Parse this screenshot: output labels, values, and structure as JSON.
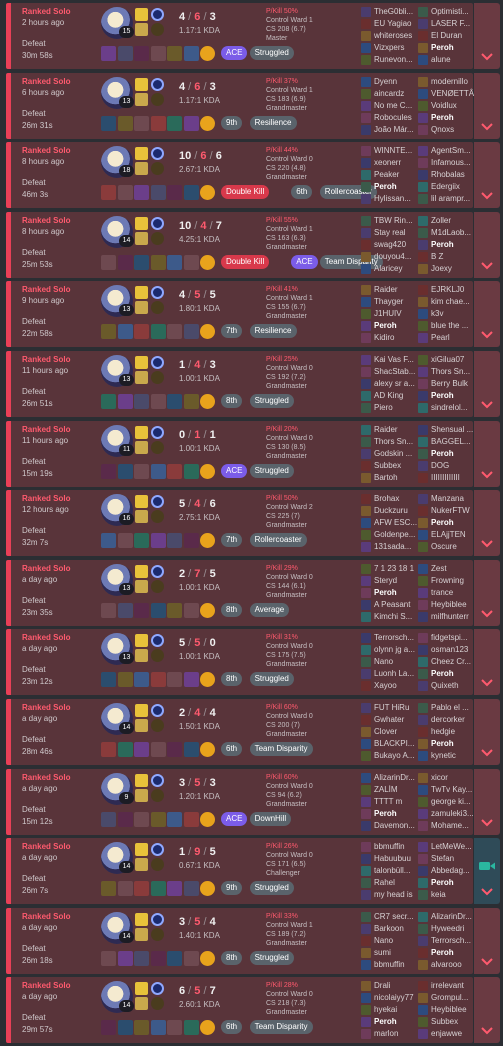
{
  "colors": {
    "defeat_bg": "#59343a",
    "defeat_border": "#e84057",
    "loss_text": "#ff5a6e",
    "badge_purple": "#7b5ce8",
    "badge_gray": "#5a636b",
    "badge_red": "#d8394b",
    "video_accent": "#2ab7a0"
  },
  "icons": {
    "expand": "chevron-down-icon",
    "video": "video-camera-icon"
  },
  "matches": [
    {
      "mode": "Ranked Solo",
      "ago": "2 hours ago",
      "result": "Defeat",
      "duration": "30m 58s",
      "level": "15",
      "kills": "4",
      "deaths": "6",
      "assists": "3",
      "kda": "1.17:1 KDA",
      "pkill": "P/Kill 50%",
      "ward": "Control Ward 1",
      "cs": "CS 208 (6.7)",
      "tier": "Master",
      "badges": [
        "ACE",
        "Struggled"
      ],
      "badge_colors": [
        "#7b5ce8",
        "#5a636b"
      ],
      "team1": [
        "TheG0bli...",
        "EU Yagiao",
        "whiteroses",
        "Vizxpers",
        "Runevon..."
      ],
      "team2": [
        "Optimisti...",
        "LASER F...",
        "El Duran",
        "Peroh",
        "alune"
      ],
      "me_team": 2,
      "me_index": 3,
      "items": "a",
      "video": false
    },
    {
      "mode": "Ranked Solo",
      "ago": "6 hours ago",
      "result": "Defeat",
      "duration": "26m 31s",
      "level": "13",
      "kills": "4",
      "deaths": "6",
      "assists": "3",
      "kda": "1.17:1 KDA",
      "pkill": "P/Kill 37%",
      "ward": "Control Ward 1",
      "cs": "CS 183 (6.9)",
      "tier": "Grandmaster",
      "badges": [
        "9th",
        "Resilience"
      ],
      "badge_colors": [
        "#5a636b",
        "#5a636b"
      ],
      "team1": [
        "Dyenn",
        "aincardz",
        "No me C...",
        "Robocules",
        "João Már..."
      ],
      "team2": [
        "modernillo",
        "VENØETTÂ",
        "Voidlux",
        "Peroh",
        "Qnoxs"
      ],
      "me_team": 2,
      "me_index": 3,
      "items": "b",
      "video": false
    },
    {
      "mode": "Ranked Solo",
      "ago": "8 hours ago",
      "result": "Defeat",
      "duration": "46m 3s",
      "level": "18",
      "kills": "10",
      "deaths": "6",
      "assists": "6",
      "kda": "2.67:1 KDA",
      "pkill": "P/Kill 44%",
      "ward": "Control Ward 0",
      "cs": "CS 220 (4.8)",
      "tier": "Grandmaster",
      "badges": [
        "Double Kill",
        "6th",
        "Rollercoaster"
      ],
      "badge_colors": [
        "#d8394b",
        "#5a636b",
        "#5a636b"
      ],
      "team1": [
        "WINNTE...",
        "xeonerr",
        "Peaker",
        "Peroh",
        "Hylissan..."
      ],
      "team2": [
        "AgentSm...",
        "Infamous...",
        "Rhobalas",
        "Edergiix",
        "lil arampr..."
      ],
      "me_team": 1,
      "me_index": 3,
      "items": "c",
      "video": false
    },
    {
      "mode": "Ranked Solo",
      "ago": "8 hours ago",
      "result": "Defeat",
      "duration": "25m 53s",
      "level": "14",
      "kills": "10",
      "deaths": "4",
      "assists": "7",
      "kda": "4.25:1 KDA",
      "pkill": "P/Kill 55%",
      "ward": "Control Ward 1",
      "cs": "CS 163 (6.3)",
      "tier": "Grandmaster",
      "badges": [
        "Double Kill",
        "ACE",
        "Team Disparity"
      ],
      "badge_colors": [
        "#d8394b",
        "#7b5ce8",
        "#5a636b"
      ],
      "team1": [
        "TBW Rin...",
        "Stay real",
        "swag420",
        "douyou4...",
        "Alaricey"
      ],
      "team2": [
        "Zoller",
        "M1dLaob...",
        "Peroh",
        "B Z",
        "Joexy"
      ],
      "me_team": 2,
      "me_index": 2,
      "items": "d",
      "video": false
    },
    {
      "mode": "Ranked Solo",
      "ago": "9 hours ago",
      "result": "Defeat",
      "duration": "22m 58s",
      "level": "13",
      "kills": "4",
      "deaths": "5",
      "assists": "5",
      "kda": "1.80:1 KDA",
      "pkill": "P/Kill 41%",
      "ward": "Control Ward 1",
      "cs": "CS 155 (6.7)",
      "tier": "Grandmaster",
      "badges": [
        "7th",
        "Resilience"
      ],
      "badge_colors": [
        "#5a636b",
        "#5a636b"
      ],
      "team1": [
        "Raider",
        "Thayger",
        "J1HUIV",
        "Peroh",
        "Kidiro"
      ],
      "team2": [
        "EJRKLJ0",
        "kim chae...",
        "k3v",
        "blue the ...",
        "Pearl"
      ],
      "me_team": 1,
      "me_index": 3,
      "items": "e",
      "video": false
    },
    {
      "mode": "Ranked Solo",
      "ago": "11 hours ago",
      "result": "Defeat",
      "duration": "26m 51s",
      "level": "13",
      "kills": "1",
      "deaths": "4",
      "assists": "3",
      "kda": "1.00:1 KDA",
      "pkill": "P/Kill 25%",
      "ward": "Control Ward 0",
      "cs": "CS 192 (7.2)",
      "tier": "Grandmaster",
      "badges": [
        "8th",
        "Struggled"
      ],
      "badge_colors": [
        "#5a636b",
        "#5a636b"
      ],
      "team1": [
        "Kai Vas F...",
        "ShacStab...",
        "alexy sr a...",
        "AD King",
        "Piero"
      ],
      "team2": [
        "xiGilua07",
        "Thors Sn...",
        "Berry Bulk",
        "Peroh",
        "sindrelol..."
      ],
      "me_team": 2,
      "me_index": 3,
      "items": "f",
      "video": false
    },
    {
      "mode": "Ranked Solo",
      "ago": "11 hours ago",
      "result": "Defeat",
      "duration": "15m 19s",
      "level": "11",
      "kills": "0",
      "deaths": "1",
      "assists": "1",
      "kda": "1.00:1 KDA",
      "pkill": "P/Kill 20%",
      "ward": "Control Ward 0",
      "cs": "CS 130 (8.5)",
      "tier": "Grandmaster",
      "badges": [
        "ACE",
        "Struggled"
      ],
      "badge_colors": [
        "#7b5ce8",
        "#5a636b"
      ],
      "team1": [
        "Raider",
        "Thors Sn...",
        "Godskin ...",
        "Subbex",
        "Bartoh"
      ],
      "team2": [
        "Shensual ...",
        "BAGGEL...",
        "Peroh",
        "DOG",
        "IIIIIIIIIIIII"
      ],
      "me_team": 2,
      "me_index": 2,
      "items": "g",
      "video": false
    },
    {
      "mode": "Ranked Solo",
      "ago": "12 hours ago",
      "result": "Defeat",
      "duration": "32m 7s",
      "level": "16",
      "kills": "5",
      "deaths": "4",
      "assists": "6",
      "kda": "2.75:1 KDA",
      "pkill": "P/Kill 50%",
      "ward": "Control Ward 2",
      "cs": "CS 225 (7)",
      "tier": "Grandmaster",
      "badges": [
        "7th",
        "Rollercoaster"
      ],
      "badge_colors": [
        "#5a636b",
        "#5a636b"
      ],
      "team1": [
        "Brohax",
        "Duckzuru",
        "AFW ESC...",
        "Goldenpe...",
        "131sada..."
      ],
      "team2": [
        "Manzana",
        "NukerFTW",
        "Peroh",
        "ELAjjTEN",
        "Oscure"
      ],
      "me_team": 2,
      "me_index": 2,
      "items": "h",
      "video": false
    },
    {
      "mode": "Ranked Solo",
      "ago": "a day ago",
      "result": "Defeat",
      "duration": "23m 35s",
      "level": "13",
      "kills": "2",
      "deaths": "7",
      "assists": "5",
      "kda": "1.00:1 KDA",
      "pkill": "P/Kill 29%",
      "ward": "Control Ward 0",
      "cs": "CS 144 (6.1)",
      "tier": "Grandmaster",
      "badges": [
        "8th",
        "Average"
      ],
      "badge_colors": [
        "#5a636b",
        "#5a636b"
      ],
      "team1": [
        "7 1 23 18 1",
        "Steryd",
        "Peroh",
        "A Peasant",
        "Kimchi S..."
      ],
      "team2": [
        "Zest",
        "Frowning",
        "trance",
        "Heybiblee",
        "milfhunterr"
      ],
      "me_team": 1,
      "me_index": 2,
      "items": "i",
      "video": false
    },
    {
      "mode": "Ranked Solo",
      "ago": "a day ago",
      "result": "Defeat",
      "duration": "23m 12s",
      "level": "13",
      "kills": "5",
      "deaths": "5",
      "assists": "0",
      "kda": "1.00:1 KDA",
      "pkill": "P/Kill 31%",
      "ward": "Control Ward 0",
      "cs": "CS 175 (7.5)",
      "tier": "Grandmaster",
      "badges": [
        "8th",
        "Struggled"
      ],
      "badge_colors": [
        "#5a636b",
        "#5a636b"
      ],
      "team1": [
        "Terrorsch...",
        "olynn jg a...",
        "Nano",
        "Luonh La...",
        "Xayoo"
      ],
      "team2": [
        "fidgetspi...",
        "osman123",
        "Cheez Cr...",
        "Peroh",
        "Quixeth"
      ],
      "me_team": 2,
      "me_index": 3,
      "items": "j",
      "video": false
    },
    {
      "mode": "Ranked Solo",
      "ago": "a day ago",
      "result": "Defeat",
      "duration": "28m 46s",
      "level": "14",
      "kills": "2",
      "deaths": "4",
      "assists": "4",
      "kda": "1.50:1 KDA",
      "pkill": "P/Kill 60%",
      "ward": "Control Ward 0",
      "cs": "CS 200 (7)",
      "tier": "Grandmaster",
      "badges": [
        "6th",
        "Team Disparity"
      ],
      "badge_colors": [
        "#5a636b",
        "#5a636b"
      ],
      "team1": [
        "FUT HiRu",
        "Gwhater",
        "Clover",
        "BLACKPI...",
        "Bukayo A..."
      ],
      "team2": [
        "Pablo el ...",
        "dercorker",
        "hedgie",
        "Peroh",
        "kynetic"
      ],
      "me_team": 2,
      "me_index": 3,
      "items": "k",
      "video": false
    },
    {
      "mode": "Ranked Solo",
      "ago": "a day ago",
      "result": "Defeat",
      "duration": "15m 12s",
      "level": "9",
      "kills": "3",
      "deaths": "5",
      "assists": "3",
      "kda": "1.20:1 KDA",
      "pkill": "P/Kill 60%",
      "ward": "Control Ward 0",
      "cs": "CS 94 (6.2)",
      "tier": "Grandmaster",
      "badges": [
        "ACE",
        "DownHill"
      ],
      "badge_colors": [
        "#7b5ce8",
        "#5a636b"
      ],
      "team1": [
        "AlizarinDr...",
        "ZALİM",
        "TTTT m",
        "Peroh",
        "Davemon..."
      ],
      "team2": [
        "xicor",
        "TwTv Kay...",
        "george ki...",
        "zamuleki3...",
        "Mohame..."
      ],
      "me_team": 1,
      "me_index": 3,
      "items": "l",
      "video": false
    },
    {
      "mode": "Ranked Solo",
      "ago": "a day ago",
      "result": "Defeat",
      "duration": "26m 7s",
      "level": "14",
      "kills": "1",
      "deaths": "9",
      "assists": "5",
      "kda": "0.67:1 KDA",
      "pkill": "P/Kill 26%",
      "ward": "Control Ward 0",
      "cs": "CS 171 (6.5)",
      "tier": "Challenger",
      "badges": [
        "9th",
        "Struggled"
      ],
      "badge_colors": [
        "#5a636b",
        "#5a636b"
      ],
      "team1": [
        "bbmuffin",
        "Habuubuu",
        "talonbüll...",
        "Rahel",
        "my head is"
      ],
      "team2": [
        "LetMeWe...",
        "Stefan",
        "Abbedag...",
        "Peroh",
        "keia"
      ],
      "me_team": 2,
      "me_index": 3,
      "items": "m",
      "video": true
    },
    {
      "mode": "Ranked Solo",
      "ago": "a day ago",
      "result": "Defeat",
      "duration": "26m 18s",
      "level": "14",
      "kills": "3",
      "deaths": "5",
      "assists": "4",
      "kda": "1.40:1 KDA",
      "pkill": "P/Kill 33%",
      "ward": "Control Ward 1",
      "cs": "CS 189 (7.2)",
      "tier": "Grandmaster",
      "badges": [
        "8th",
        "Struggled"
      ],
      "badge_colors": [
        "#5a636b",
        "#5a636b"
      ],
      "team1": [
        "CR7 secr...",
        "Barkoon",
        "Nano",
        "sumi",
        "bbmuffin"
      ],
      "team2": [
        "AlizarinDr...",
        "Hyweedri",
        "Terrorsch...",
        "Peroh",
        "alvarooo"
      ],
      "me_team": 2,
      "me_index": 3,
      "items": "n",
      "video": false
    },
    {
      "mode": "Ranked Solo",
      "ago": "a day ago",
      "result": "Defeat",
      "duration": "29m 57s",
      "level": "14",
      "kills": "6",
      "deaths": "5",
      "assists": "7",
      "kda": "2.60:1 KDA",
      "pkill": "P/Kill 28%",
      "ward": "Control Ward 0",
      "cs": "CS 218 (7.3)",
      "tier": "Grandmaster",
      "badges": [
        "6th",
        "Team Disparity"
      ],
      "badge_colors": [
        "#5a636b",
        "#5a636b"
      ],
      "team1": [
        "Drali",
        "nicolaiyy77",
        "hyekai",
        "Peroh",
        "marlon"
      ],
      "team2": [
        "irrelevant",
        "Grompul...",
        "Heybiblee",
        "Subbex",
        "enjawwe"
      ],
      "me_team": 1,
      "me_index": 3,
      "items": "o",
      "video": false
    }
  ]
}
